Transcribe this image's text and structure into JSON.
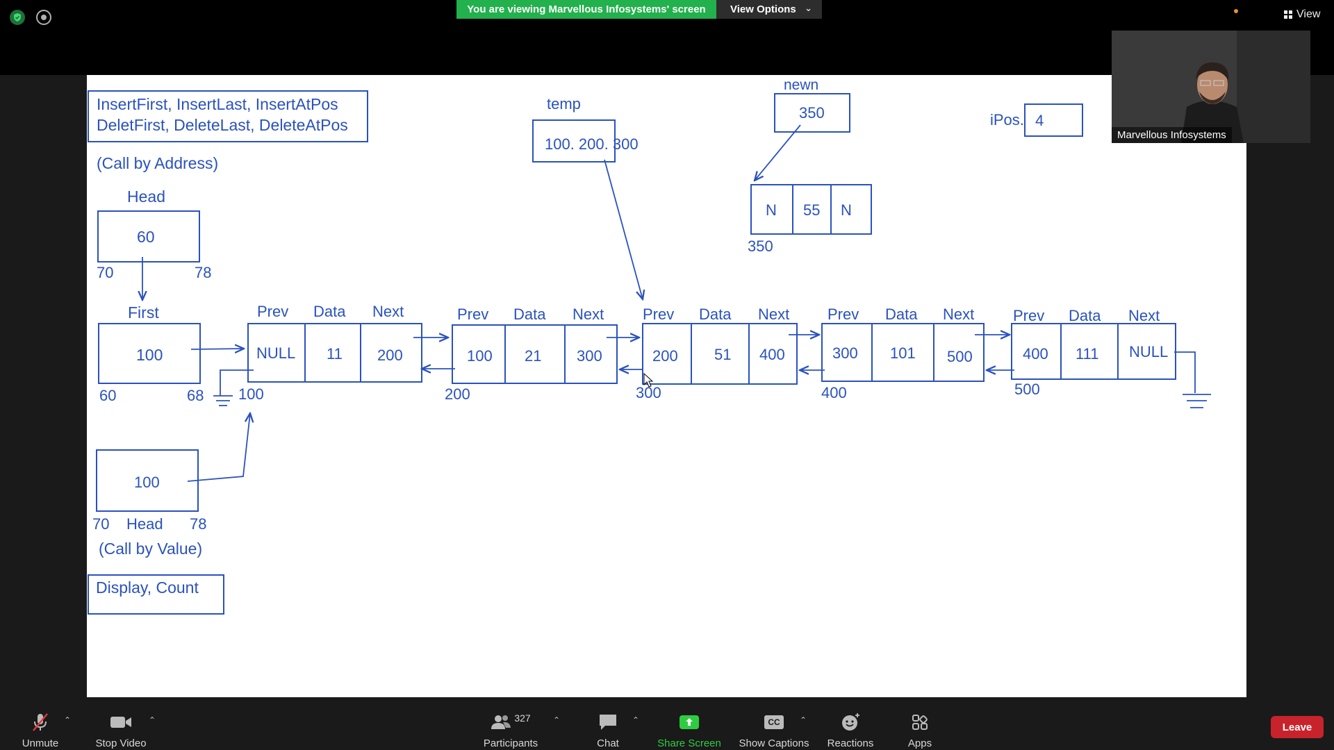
{
  "top_bar": {
    "viewing_banner": "You are viewing Marvellous Infosystems' screen",
    "view_options_label": "View Options",
    "view_label": "View"
  },
  "video_tile": {
    "participant_name": "Marvellous Infosystems"
  },
  "whiteboard": {
    "function_box_line1": "InsertFirst, InsertLast, InsertAtPos",
    "function_box_line2": "DeletFirst, DeleteLast, DeleteAtPos",
    "call_by_address": "(Call by Address)",
    "head_label": "Head",
    "head_value": "60",
    "head_addr_left": "70",
    "head_addr_right": "78",
    "first_label": "First",
    "first_value": "100",
    "first_addr_left": "60",
    "first_addr_right": "68",
    "temp_label": "temp",
    "temp_value": "100. 200. 300",
    "newn_label": "newn",
    "newn_value": "350",
    "new_node": {
      "prev": "N",
      "data": "55",
      "next": "N",
      "address": "350"
    },
    "ipos_label": "iPos.",
    "ipos_value": "4",
    "nodes": [
      {
        "prev_label": "Prev",
        "data_label": "Data",
        "next_label": "Next",
        "prev": "NULL",
        "data": "11",
        "next": "200",
        "address": "100"
      },
      {
        "prev_label": "Prev",
        "data_label": "Data",
        "next_label": "Next",
        "prev": "100",
        "data": "21",
        "next": "300",
        "address": "200"
      },
      {
        "prev_label": "Prev",
        "data_label": "Data",
        "next_label": "Next",
        "prev": "200",
        "data": "51",
        "next": "400",
        "address": "300"
      },
      {
        "prev_label": "Prev",
        "data_label": "Data",
        "next_label": "Next",
        "prev": "300",
        "data": "101",
        "next": "500",
        "address": "400"
      },
      {
        "prev_label": "Prev",
        "data_label": "Data",
        "next_label": "Next",
        "prev": "400",
        "data": "111",
        "next": "NULL",
        "address": "500"
      }
    ],
    "call_by_value_box_value": "100",
    "cbv_addr_left": "70",
    "cbv_head_label": "Head",
    "cbv_addr_right": "78",
    "call_by_value": "(Call by Value)",
    "display_count": "Display, Count",
    "ink_color": "#2a52be"
  },
  "toolbar": {
    "unmute": "Unmute",
    "stop_video": "Stop Video",
    "participants": "Participants",
    "participants_count": "327",
    "chat": "Chat",
    "share_screen": "Share Screen",
    "show_captions": "Show Captions",
    "captions_badge": "CC",
    "reactions": "Reactions",
    "apps": "Apps",
    "leave": "Leave"
  },
  "colors": {
    "banner_green": "#22b14c",
    "leave_red": "#c8232c",
    "share_green": "#2ecc40"
  }
}
